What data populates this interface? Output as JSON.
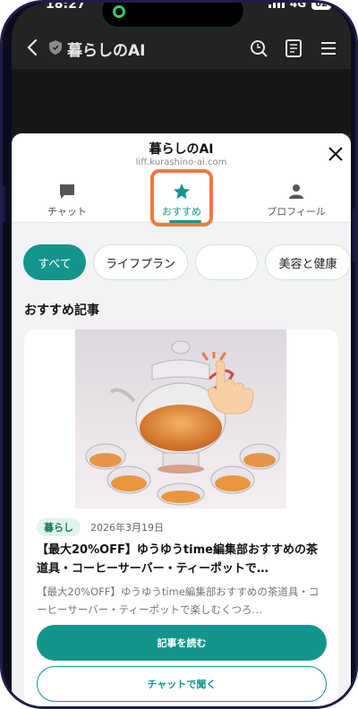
{
  "status_bar": {
    "time": "18:27",
    "network": "4G",
    "battery": "62"
  },
  "app_header": {
    "title": "暮らしのAI"
  },
  "sheet": {
    "title": "暮らしのAI",
    "url": "liff.kurashino-ai.com",
    "tabs": [
      {
        "label": "チャット",
        "icon": "chat-icon"
      },
      {
        "label": "おすすめ",
        "icon": "star-icon",
        "active": true
      },
      {
        "label": "プロフィール",
        "icon": "person-icon"
      }
    ]
  },
  "chips": [
    "すべて",
    "ライフプラン",
    "",
    "美容と健康"
  ],
  "section_title": "おすすめ記事",
  "article": {
    "tag": "暮らし",
    "date": "2026年3月19日",
    "title": "【最大20%OFF】ゆうゆうtime編集部おすすめの茶道具・コーヒーサーバー・ティーポットで…",
    "excerpt": "【最大20%OFF】ゆうゆうtime編集部おすすめの茶道具・コーヒーサーバー・ティーポットで楽しむくつろ…",
    "read_button": "記事を読む",
    "chat_button": "チャットで聞く"
  },
  "colors": {
    "accent": "#13958d",
    "highlight": "#ef7a3c"
  }
}
